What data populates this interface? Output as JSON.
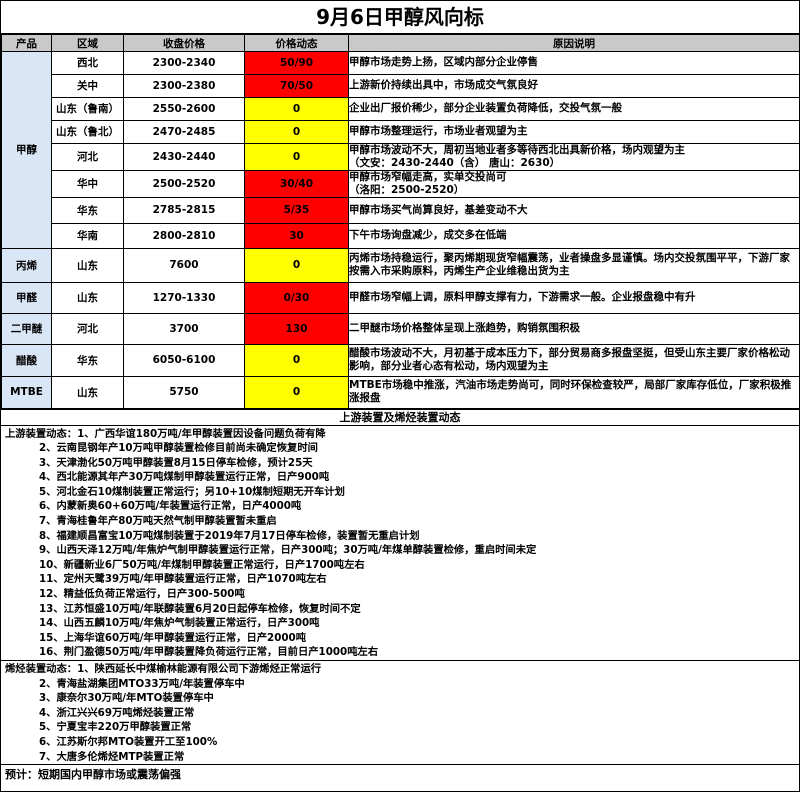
{
  "title": "9月6日甲醇风向标",
  "headers": [
    "产品",
    "区域",
    "收盘价格",
    "价格动态",
    "原因说明"
  ],
  "products": [
    {
      "name": "甲醇",
      "rows": [
        {
          "region": "西北",
          "price": "2300-2340",
          "change": "50/90",
          "color": "red",
          "reason": [
            "甲醇市场走势上扬，区域内部分企业停售"
          ]
        },
        {
          "region": "关中",
          "price": "2300-2380",
          "change": "70/50",
          "color": "red",
          "reason": [
            "上游新价持续出具中，市场成交气氛良好"
          ]
        },
        {
          "region": "山东（鲁南）",
          "price": "2550-2600",
          "change": "0",
          "color": "yellow",
          "reason": [
            "企业出厂报价稀少，部分企业装置负荷降低，交投气氛一般"
          ]
        },
        {
          "region": "山东（鲁北）",
          "price": "2470-2485",
          "change": "0",
          "color": "yellow",
          "reason": [
            "甲醇市场整理运行，市场业者观望为主"
          ]
        },
        {
          "region": "河北",
          "price": "2430-2440",
          "change": "0",
          "color": "yellow",
          "reason": [
            "甲醇市场波动不大，周初当地业者多等待西北出具新价格，场内观望为主",
            "（文安：2430-2440（含） 唐山：2630）"
          ]
        },
        {
          "region": "华中",
          "price": "2500-2520",
          "change": "30/40",
          "color": "red",
          "reason": [
            "甲醇市场窄幅走高，实单交投尚可",
            "（洛阳：2500-2520）"
          ]
        },
        {
          "region": "华东",
          "price": "2785-2815",
          "change": "5/35",
          "color": "red",
          "reason": [
            "甲醇市场买气尚算良好，基差变动不大"
          ]
        },
        {
          "region": "华南",
          "price": "2800-2810",
          "change": "30",
          "color": "red",
          "reason": [
            "下午市场询盘减少，成交多在低端"
          ]
        }
      ]
    },
    {
      "name": "丙烯",
      "rows": [
        {
          "region": "山东",
          "price": "7600",
          "change": "0",
          "color": "yellow",
          "reason": [
            "丙烯市场持稳运行，聚丙烯期现货窄幅震荡，业者操盘多显谨慎。场内交投氛围平平，下游厂家",
            "按需入市采购原料，丙烯生产企业维稳出货为主"
          ]
        }
      ]
    },
    {
      "name": "甲醛",
      "rows": [
        {
          "region": "山东",
          "price": "1270-1330",
          "change": "0/30",
          "color": "red",
          "reason": [
            "甲醛市场窄幅上调，原料甲醇支撑有力，下游需求一般。企业报盘稳中有升"
          ]
        }
      ]
    },
    {
      "name": "二甲醚",
      "rows": [
        {
          "region": "河北",
          "price": "3700",
          "change": "130",
          "color": "red",
          "reason": [
            "二甲醚市场价格整体呈现上涨趋势，购销氛围积极"
          ]
        }
      ]
    },
    {
      "name": "醋酸",
      "rows": [
        {
          "region": "华东",
          "price": "6050-6100",
          "change": "0",
          "color": "yellow",
          "reason": [
            "醋酸市场波动不大，月初基于成本压力下，部分贸易商多报盘坚挺，但受山东主要厂家价格松动",
            "影响，部分业者心态有松动，场内观望为主"
          ]
        }
      ]
    },
    {
      "name": "MTBE",
      "rows": [
        {
          "region": "山东",
          "price": "5750",
          "change": "0",
          "color": "yellow",
          "reason": [
            "MTBE市场稳中推涨，汽油市场走势尚可，同时环保检查较严，局部厂家库存低位，厂家积极推",
            "涨报盘"
          ]
        }
      ]
    }
  ],
  "section_title": "上游装置及烯烃装置动态",
  "upstream": {
    "label": "上游装置动态：",
    "items": [
      "1、广西华谊180万吨/年甲醇装置因设备问题负荷有降",
      "2、云南昆钢年产10万吨甲醇装置检修目前尚未确定恢复时间",
      "3、天津渤化50万吨甲醇装置8月15日停车检修，预计25天",
      "4、西北能源其年产30万吨煤制甲醇装置运行正常，日产900吨",
      "5、河北金石10煤制装置正常运行；另10+10煤制短期无开车计划",
      "6、内蒙新奥60+60万吨/年装置运行正常，日产4000吨",
      "7、青海桂鲁年产80万吨天然气制甲醇装置暂未重启",
      "8、福建顺昌富宝10万吨煤制装置于2019年7月17日停车检修，装置暂无重启计划",
      "9、山西天泽12万吨/年焦炉气制甲醇装置运行正常，日产300吨；30万吨/年煤单醇装置检修，重启时间未定",
      "10、新疆新业6厂50万吨/年煤制甲醇装置正常运行，日产1700吨左右",
      "11、定州天鹭39万吨/年甲醇装置运行正常，日产1070吨左右",
      "12、精益低负荷正常运行，日产300-500吨",
      "13、江苏恒盛10万吨/年联醇装置6月20日起停车检修，恢复时间不定",
      "14、山西五麟10万吨/年焦炉气制装置正常运行，日产300吨",
      "15、上海华谊60万吨/年甲醇装置运行正常，日产2000吨",
      "16、荆门盈德50万吨/年甲醇装置降负荷运行正常，目前日产1000吨左右"
    ]
  },
  "olefin": {
    "label": "烯烃装置动态：",
    "items": [
      "1、陕西延长中煤榆林能源有限公司下游烯烃正常运行",
      "2、青海盐湖集团MTO33万吨/年装置停车中",
      "3、康奈尔30万吨/年MTO装置停车中",
      "4、浙江兴兴69万吨烯烃装置正常",
      "5、宁夏宝丰220万甲醇装置正常",
      "6、江苏斯尔邦MTO装置开工至100%",
      "7、大唐多伦烯烃MTP装置正常"
    ]
  },
  "forecast": "预计：短期国内甲醇市场或震荡偏强",
  "colors": {
    "red": "#ff0000",
    "yellow": "#ffff00",
    "header_gray": "#c9c9c9",
    "product_blue": "#d9e6f5"
  }
}
